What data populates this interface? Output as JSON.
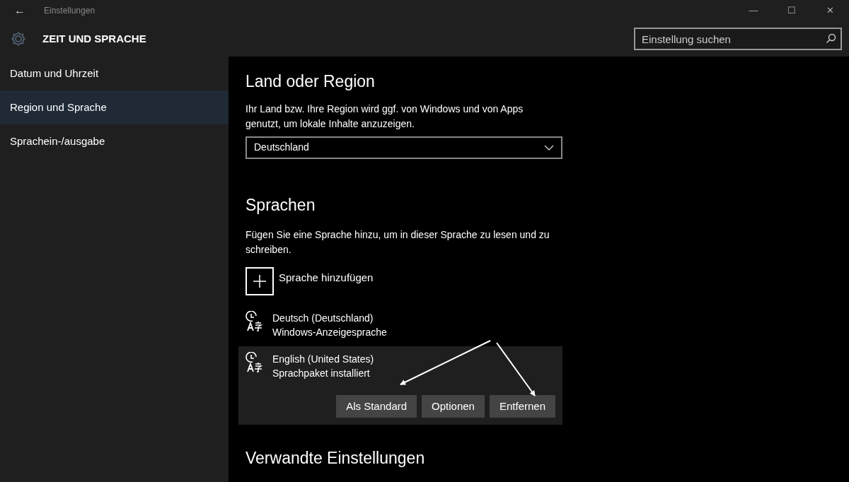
{
  "window": {
    "title": "Einstellungen",
    "back": "←",
    "controls": [
      "—",
      "☐",
      "✕"
    ]
  },
  "header": {
    "title": "ZEIT UND SPRACHE"
  },
  "search": {
    "placeholder": "Einstellung suchen"
  },
  "sidebar": {
    "items": [
      {
        "label": "Datum und Uhrzeit",
        "selected": false
      },
      {
        "label": "Region und Sprache",
        "selected": true
      },
      {
        "label": "Sprachein-/ausgabe",
        "selected": false
      }
    ]
  },
  "region": {
    "heading": "Land oder Region",
    "description": "Ihr Land bzw. Ihre Region wird ggf. von Windows und von Apps genutzt, um lokale Inhalte anzuzeigen.",
    "country": "Deutschland"
  },
  "languages": {
    "heading": "Sprachen",
    "description": "Fügen Sie eine Sprache hinzu, um in dieser Sprache zu lesen und zu schreiben.",
    "add_label": "Sprache hinzufügen",
    "items": [
      {
        "name": "Deutsch (Deutschland)",
        "status": "Windows-Anzeigesprache",
        "selected": false
      },
      {
        "name": "English (United States)",
        "status": "Sprachpaket installiert",
        "selected": true,
        "buttons": [
          "Als Standard",
          "Optionen",
          "Entfernen"
        ]
      }
    ]
  },
  "related": {
    "heading": "Verwandte Einstellungen"
  }
}
